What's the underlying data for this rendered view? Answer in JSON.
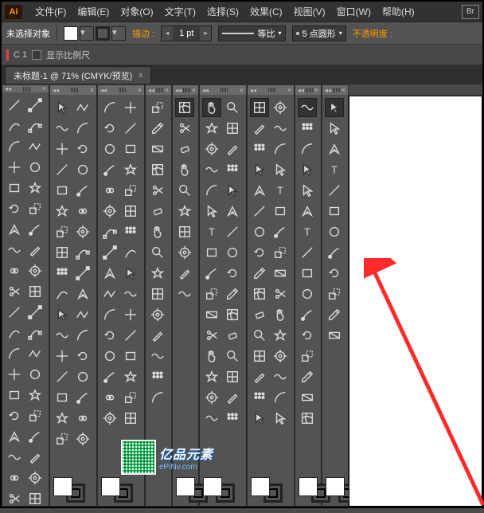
{
  "app": {
    "logo": "Ai"
  },
  "menu": {
    "items": [
      "文件(F)",
      "编辑(E)",
      "对象(O)",
      "文字(T)",
      "选择(S)",
      "效果(C)",
      "视图(V)",
      "窗口(W)",
      "帮助(H)"
    ],
    "bridge": "Br"
  },
  "control": {
    "no_selection": "未选择对象",
    "stroke_label": "描边 :",
    "stroke_value": "1 pt",
    "profile_label": "等比",
    "brush_label": "5 点圆形",
    "opacity_label": "不透明度 :"
  },
  "ruler": {
    "c1": "C 1",
    "show_ruler": "显示比例尺"
  },
  "tab": {
    "title": "未标题-1 @ 71% (CMYK/预览)",
    "close": "x"
  },
  "watermark": {
    "line1": "亿品元素",
    "line2": "ePiNv.com"
  },
  "panels": [
    {
      "cols": 2,
      "rows": 20,
      "proxy": false,
      "style": "red"
    },
    {
      "cols": 2,
      "rows": 17,
      "proxy": true,
      "style": "mix"
    },
    {
      "cols": 2,
      "rows": 16,
      "proxy": true,
      "style": "mix2"
    },
    {
      "cols": 1,
      "rows": 15,
      "proxy": false,
      "style": "gray"
    },
    {
      "cols": 1,
      "rows": 10,
      "proxy": true,
      "style": "gray"
    },
    {
      "cols": 2,
      "rows": 16,
      "proxy": true,
      "style": "gray"
    },
    {
      "cols": 2,
      "rows": 16,
      "proxy": true,
      "style": "gray"
    },
    {
      "cols": 1,
      "rows": 16,
      "proxy": true,
      "style": "gray"
    },
    {
      "cols": 1,
      "rows": 12,
      "proxy": true,
      "style": "gray"
    }
  ]
}
